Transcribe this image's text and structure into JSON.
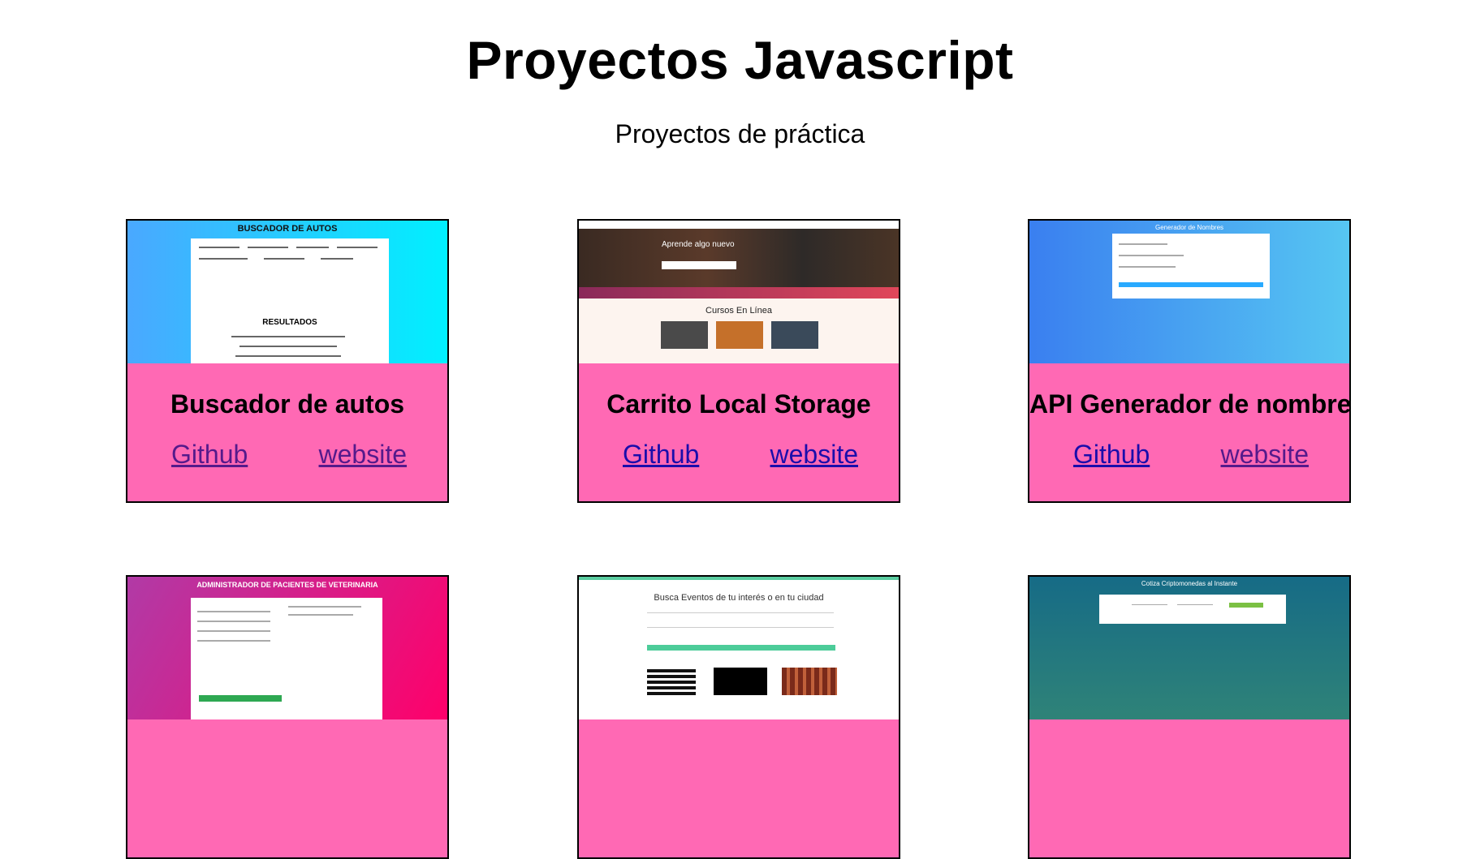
{
  "header": {
    "title": "Proyectos Javascript",
    "subtitle": "Proyectos de práctica"
  },
  "projects": [
    {
      "title": "Buscador de autos",
      "github_label": "Github",
      "website_label": "website",
      "thumb": {
        "title": "BUSCADOR DE AUTOS",
        "heading": "RESULTADOS"
      }
    },
    {
      "title": "Carrito Local Storage",
      "github_label": "Github",
      "website_label": "website",
      "thumb": {
        "hero_text": "Aprende algo nuevo",
        "heading": "Cursos En Línea"
      }
    },
    {
      "title": "API Generador de nombres",
      "github_label": "Github",
      "website_label": "website",
      "thumb": {
        "title": "Generador de Nombres"
      }
    },
    {
      "title": "",
      "thumb": {
        "title": "ADMINISTRADOR DE PACIENTES DE VETERINARIA"
      }
    },
    {
      "title": "",
      "thumb": {
        "title": "Busca Eventos de tu interés o en tu ciudad"
      }
    },
    {
      "title": "",
      "thumb": {
        "title": "Cotiza Criptomonedas al Instante"
      }
    }
  ],
  "colors": {
    "card_body": "#ff69b4",
    "link": "#1a0dab",
    "link_visited": "#551a8b"
  }
}
